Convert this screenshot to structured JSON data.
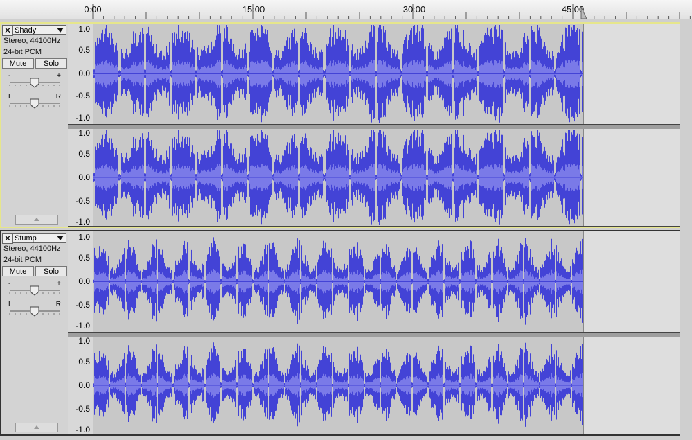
{
  "timeline": {
    "labels": [
      "0:00",
      "15:00",
      "30:00",
      "45:00"
    ]
  },
  "colors": {
    "wave": "#4343d6",
    "wave_rms": "#7a7ae8",
    "audio_bg": "#c8c8c8",
    "empty_bg": "#dedede",
    "selected_border": "#e6e68c"
  },
  "amplitude_labels": [
    "1.0",
    "0.5",
    "0.0",
    "-0.5",
    "-1.0"
  ],
  "tracks": [
    {
      "name": "Shady",
      "format": "Stereo, 44100Hz",
      "bitdepth": "24-bit PCM",
      "mute_label": "Mute",
      "solo_label": "Solo",
      "gain_minus": "-",
      "gain_plus": "+",
      "pan_left": "L",
      "pan_right": "R",
      "selected": true
    },
    {
      "name": "Stump",
      "format": "Stereo, 44100Hz",
      "bitdepth": "24-bit PCM",
      "mute_label": "Mute",
      "solo_label": "Solo",
      "gain_minus": "-",
      "gain_plus": "+",
      "pan_left": "L",
      "pan_right": "R",
      "selected": false
    }
  ]
}
